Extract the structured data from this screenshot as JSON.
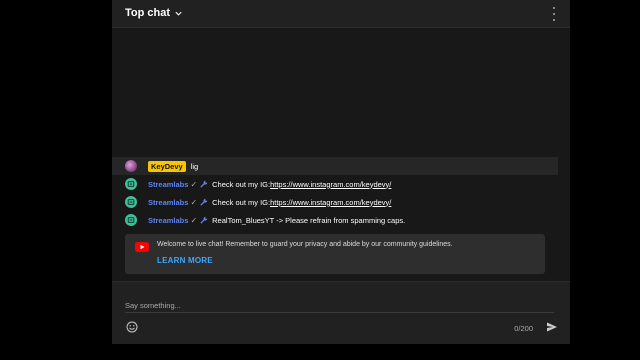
{
  "header": {
    "title": "Top chat"
  },
  "messages": [
    {
      "author": "KeyDevy",
      "text": "lig",
      "type": "user"
    },
    {
      "author": "Streamlabs",
      "prefix": "Check out my IG: ",
      "link": "https://www.instagram.com/keydevy/",
      "type": "bot"
    },
    {
      "author": "Streamlabs",
      "prefix": "Check out my IG: ",
      "link": "https://www.instagram.com/keydevy/",
      "type": "bot"
    },
    {
      "author": "Streamlabs",
      "prefix": "RealTom_BluesYT -> Please refrain from spamming caps.",
      "type": "bot"
    }
  ],
  "welcome": {
    "text": "Welcome to live chat! Remember to guard your privacy and abide by our community guidelines.",
    "learn_more": "LEARN MORE"
  },
  "composer": {
    "placeholder": "Say something...",
    "counter": "0/200"
  },
  "colors": {
    "badge": "#f7c600",
    "bot_name": "#5e84f1",
    "link_blue": "#3ea6ff",
    "bot_avatar": "#3fbf9a"
  },
  "icons": [
    "chevron-down-icon",
    "more-vert-icon",
    "streamlabs-icon",
    "verified-check-icon",
    "wrench-icon",
    "youtube-icon",
    "emoji-icon",
    "send-icon"
  ]
}
